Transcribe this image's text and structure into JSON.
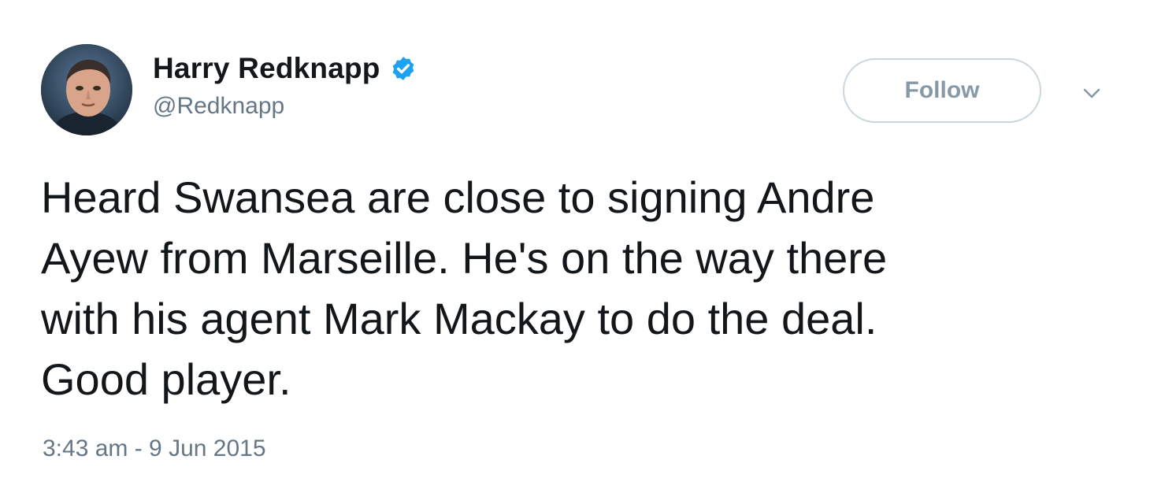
{
  "tweet": {
    "author": {
      "display_name": "Harry Redknapp",
      "handle": "@Redknapp",
      "verified": true,
      "avatar_icon": "profile-photo"
    },
    "follow_label": "Follow",
    "more_icon": "chevron-down-icon",
    "text": "Heard Swansea are close to signing Andre\nAyew from Marseille. He's on the way there\nwith his agent Mark Mackay to do the deal.\nGood player.",
    "timestamp": "3:43 am - 9 Jun 2015"
  },
  "colors": {
    "verified_blue": "#1da1f2",
    "secondary_text": "#657786",
    "primary_text": "#14171a",
    "follow_border": "#ccd6dd",
    "follow_text": "#8899a6"
  }
}
